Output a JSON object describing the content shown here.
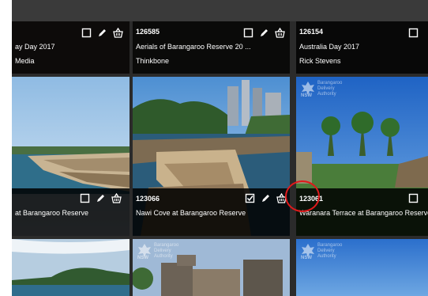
{
  "colors": {
    "caption_bg": "#000000",
    "caption_text": "#ffffff",
    "highlight": "#e0191b"
  },
  "tiles": [
    {
      "id": "",
      "title": "ay Day 2017",
      "author": "Media"
    },
    {
      "id": "126585",
      "title": "Aerials of Barangaroo Reserve 20 ...",
      "author": "Thinkbone"
    },
    {
      "id": "126154",
      "title": "Australia Day 2017",
      "author": "Rick Stevens"
    },
    {
      "id": "",
      "title": "at Barangaroo Reserve",
      "author": ""
    },
    {
      "id": "123066",
      "title": "Nawi Cove at Barangaroo Reserve",
      "author": ""
    },
    {
      "id": "123061",
      "title": "Waranara Terrace at Barangaroo Reserve",
      "author": ""
    }
  ],
  "logo": {
    "line1": "Barangaroo",
    "line2": "Delivery",
    "line3": "Authority",
    "nsw": "NSW"
  },
  "icons": {
    "checkbox": "checkbox-icon",
    "edit": "pencil-icon",
    "basket": "basket-icon"
  }
}
